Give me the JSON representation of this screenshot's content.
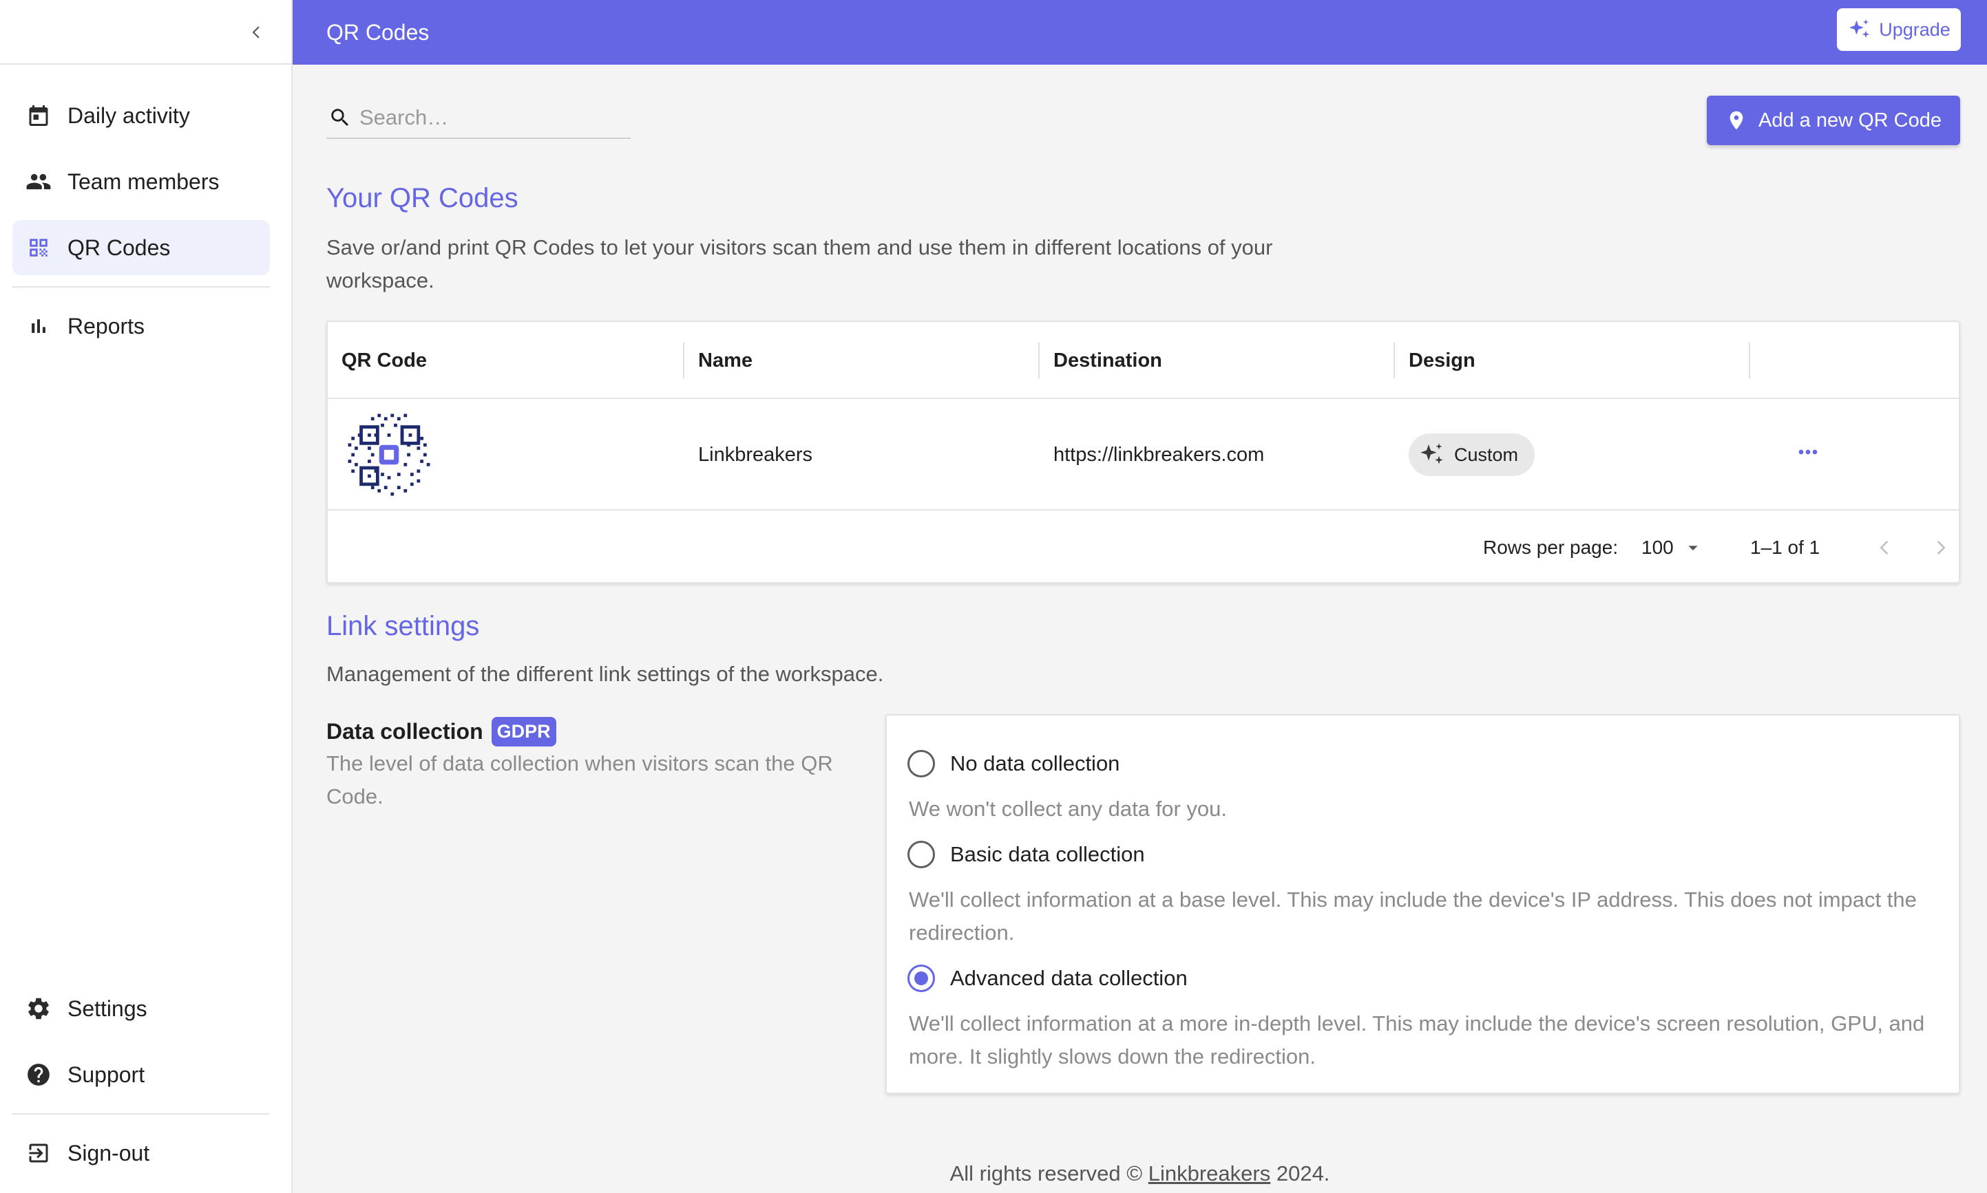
{
  "sidebar": {
    "nav": [
      {
        "label": "Daily activity",
        "icon": "calendar-icon"
      },
      {
        "label": "Team members",
        "icon": "people-icon"
      },
      {
        "label": "QR Codes",
        "icon": "qr-code-icon",
        "active": true
      },
      {
        "label": "Reports",
        "icon": "bar-chart-icon"
      }
    ],
    "bottom": [
      {
        "label": "Settings",
        "icon": "gear-icon"
      },
      {
        "label": "Support",
        "icon": "help-icon"
      },
      {
        "label": "Sign-out",
        "icon": "sign-out-icon"
      }
    ]
  },
  "header": {
    "title": "QR Codes",
    "upgrade_label": "Upgrade"
  },
  "toolbar": {
    "search_placeholder": "Search…",
    "add_label": "Add a new QR Code"
  },
  "qr_section": {
    "title": "Your QR Codes",
    "description": "Save or/and print QR Codes to let your visitors scan them and use them in different locations of your workspace."
  },
  "table": {
    "columns": [
      "QR Code",
      "Name",
      "Destination",
      "Design"
    ],
    "rows": [
      {
        "name": "Linkbreakers",
        "destination": "https://linkbreakers.com",
        "design": "Custom"
      }
    ],
    "rows_per_page_label": "Rows per page:",
    "rows_per_page": "100",
    "range": "1–1 of 1"
  },
  "link_settings": {
    "title": "Link settings",
    "description": "Management of the different link settings of the workspace.",
    "data_collection": {
      "title": "Data collection",
      "badge": "GDPR",
      "description": "The level of data collection when visitors scan the QR Code.",
      "options": [
        {
          "label": "No data collection",
          "help": "We won't collect any data for you.",
          "checked": false
        },
        {
          "label": "Basic data collection",
          "help": "We'll collect information at a base level. This may include the device's IP address. This does not impact the redirection.",
          "checked": false
        },
        {
          "label": "Advanced data collection",
          "help": "We'll collect information at a more in-depth level. This may include the device's screen resolution, GPU, and more. It slightly slows down the redirection.",
          "checked": true
        }
      ]
    }
  },
  "footer": {
    "prefix": "All rights reserved ©",
    "link": "Linkbreakers",
    "year": "2024."
  },
  "colors": {
    "accent": "#6466e4",
    "background": "#f4f4f4"
  }
}
